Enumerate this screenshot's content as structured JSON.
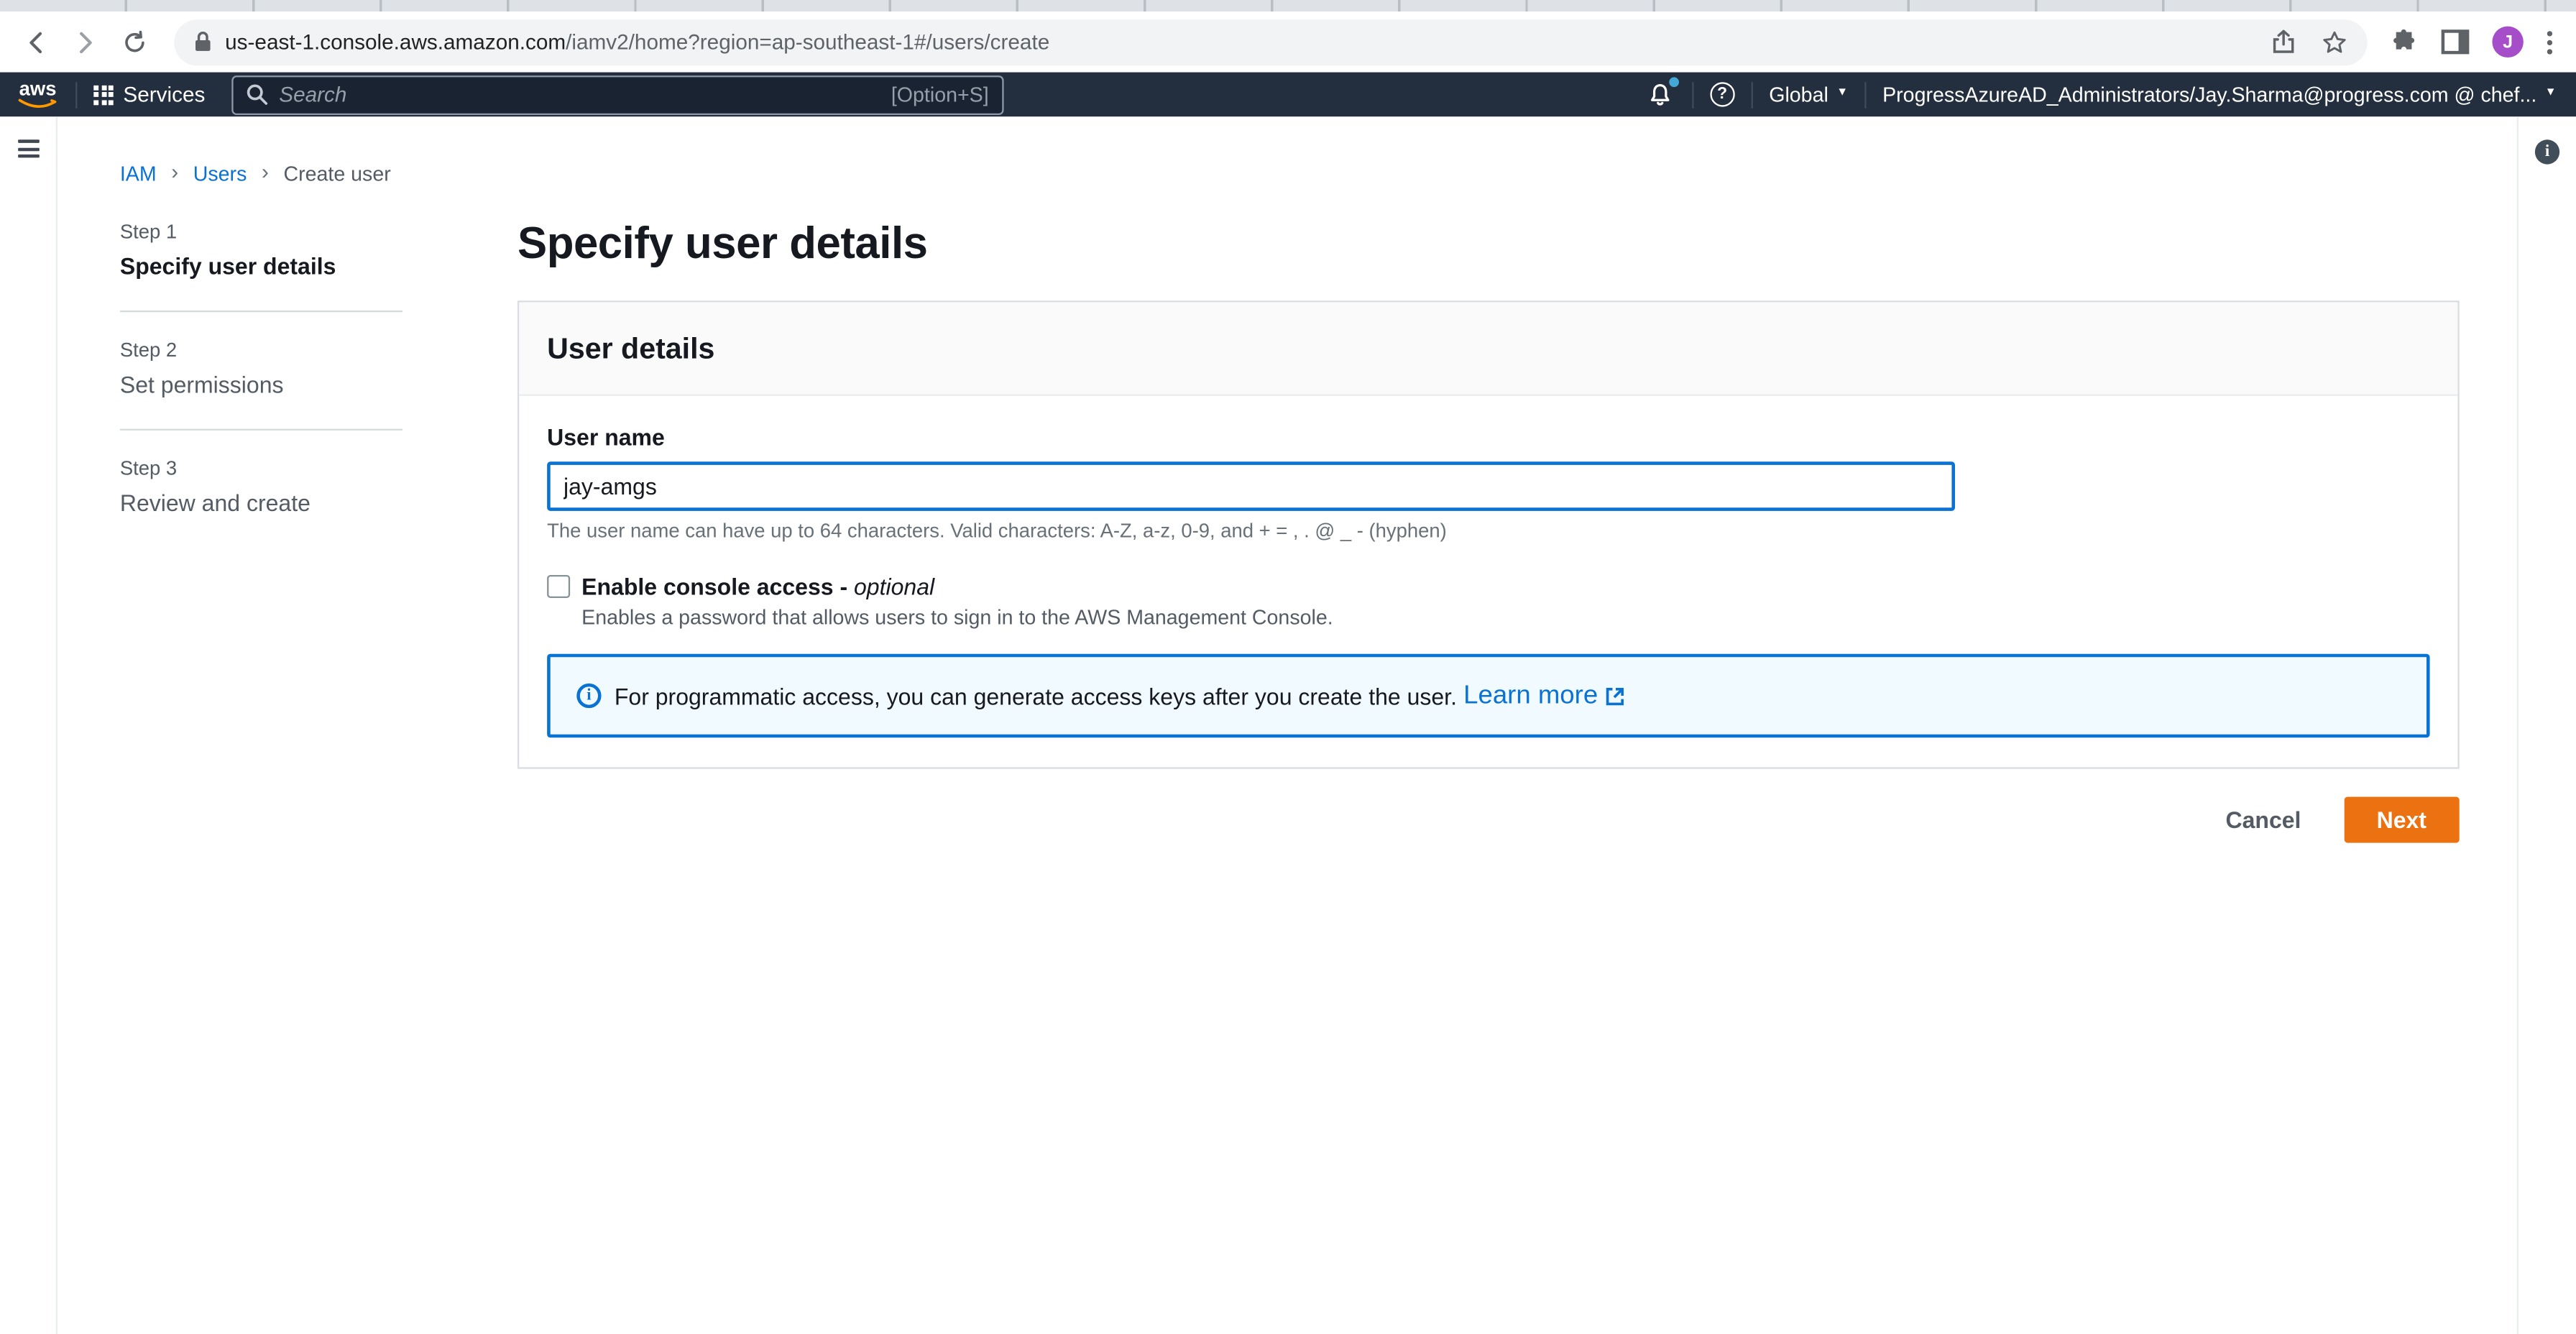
{
  "browser": {
    "url_domain": "us-east-1.console.aws.amazon.com",
    "url_path": "/iamv2/home?region=ap-southeast-1#/users/create",
    "avatar_initial": "J"
  },
  "nav": {
    "logo_text": "aws",
    "services_label": "Services",
    "search_placeholder": "Search",
    "search_shortcut": "[Option+S]",
    "region_label": "Global",
    "account_label": "ProgressAzureAD_Administrators/Jay.Sharma@progress.com @ chef..."
  },
  "breadcrumb": {
    "items": [
      {
        "label": "IAM"
      },
      {
        "label": "Users"
      },
      {
        "label": "Create user"
      }
    ]
  },
  "steps": {
    "items": [
      {
        "step": "Step 1",
        "label": "Specify user details"
      },
      {
        "step": "Step 2",
        "label": "Set permissions"
      },
      {
        "step": "Step 3",
        "label": "Review and create"
      }
    ]
  },
  "main": {
    "page_title": "Specify user details",
    "card_title": "User details",
    "username": {
      "label": "User name",
      "value": "jay-amgs",
      "constraint": "The user name can have up to 64 characters. Valid characters: A-Z, a-z, 0-9, and + = , . @ _ - (hyphen)"
    },
    "console_access": {
      "label": "Enable console access - ",
      "optional": "optional",
      "description": "Enables a password that allows users to sign in to the AWS Management Console."
    },
    "alert": {
      "text": "For programmatic access, you can generate access keys after you create the user.",
      "link_label": "Learn more"
    },
    "actions": {
      "cancel": "Cancel",
      "next": "Next"
    }
  },
  "colors": {
    "nav_dark": "#232f3e",
    "accent_orange": "#ec7211",
    "link_blue": "#0972d3",
    "alert_bg": "#f1faff"
  }
}
